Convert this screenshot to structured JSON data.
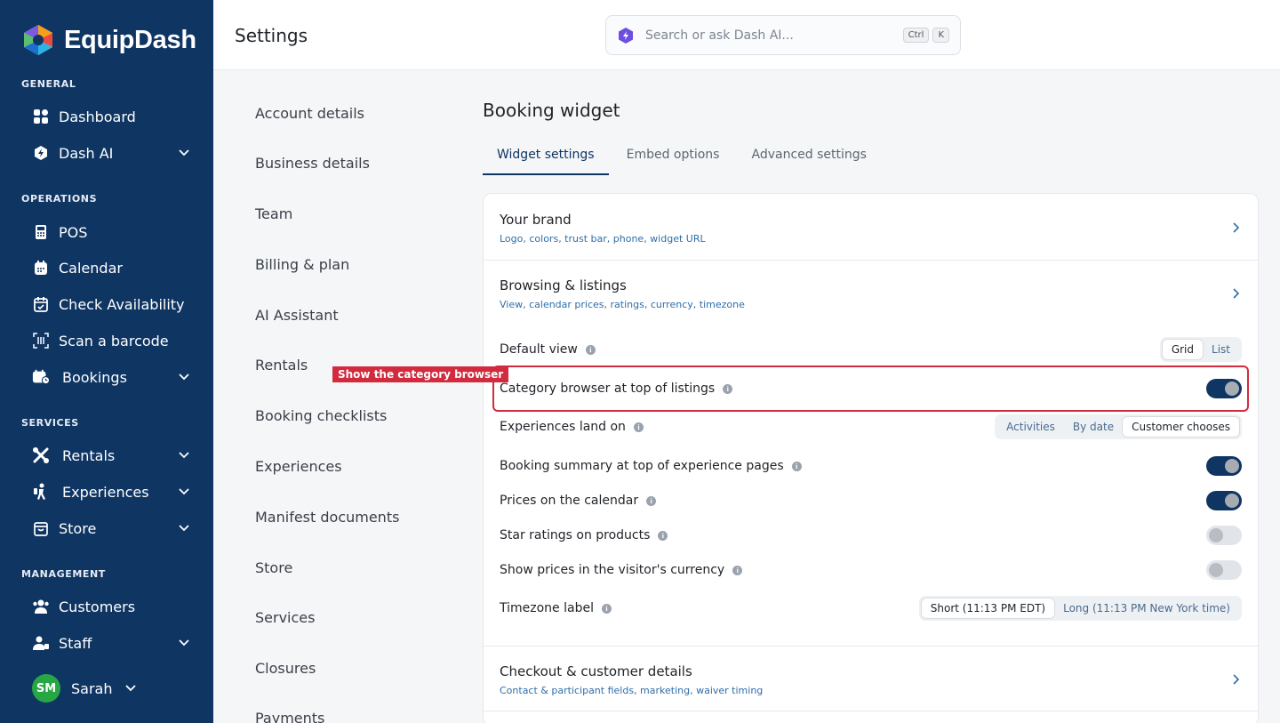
{
  "app": {
    "name": "EquipDash",
    "page_title": "Settings"
  },
  "colors": {
    "sidebar_bg": "#0f3563",
    "accent": "#0f3563",
    "callout": "#d12b3d",
    "avatar_bg": "#27a744"
  },
  "search": {
    "placeholder": "Search or ask Dash AI...",
    "shortcut_1": "Ctrl",
    "shortcut_2": "K"
  },
  "sidebar": {
    "sections": {
      "general": "GENERAL",
      "operations": "OPERATIONS",
      "services": "SERVICES",
      "management": "MANAGEMENT"
    },
    "items": [
      {
        "label": "Dashboard",
        "icon": "grid-icon"
      },
      {
        "label": "Dash AI",
        "icon": "ai-shield-icon"
      },
      {
        "label": "POS",
        "icon": "pos-terminal-icon"
      },
      {
        "label": "Calendar",
        "icon": "calendar-icon"
      },
      {
        "label": "Check Availability",
        "icon": "calendar-check-icon"
      },
      {
        "label": "Scan a barcode",
        "icon": "barcode-scan-icon"
      },
      {
        "label": "Bookings",
        "icon": "bookings-icon"
      },
      {
        "label": "Rentals",
        "icon": "rentals-icon"
      },
      {
        "label": "Experiences",
        "icon": "experiences-icon"
      },
      {
        "label": "Store",
        "icon": "store-bag-icon"
      },
      {
        "label": "Customers",
        "icon": "customers-icon"
      },
      {
        "label": "Staff",
        "icon": "staff-icon"
      }
    ],
    "user": {
      "initials": "SM",
      "name": "Sarah"
    }
  },
  "settings_nav": [
    "Account details",
    "Business details",
    "Team",
    "Billing & plan",
    "AI Assistant",
    "Rentals",
    "Booking checklists",
    "Experiences",
    "Manifest documents",
    "Store",
    "Services",
    "Closures",
    "Payments"
  ],
  "callout": "Show the category browser",
  "main": {
    "title": "Booking widget",
    "tabs": [
      "Widget settings",
      "Embed options",
      "Advanced settings"
    ],
    "groups": {
      "brand": {
        "title": "Your brand",
        "subtitle": "Logo, colors, trust bar, phone, widget URL"
      },
      "browsing": {
        "title": "Browsing & listings",
        "subtitle": "View, calendar prices, ratings, currency, timezone"
      },
      "checkout": {
        "title": "Checkout & customer details",
        "subtitle": "Contact & participant fields, marketing, waiver timing"
      }
    },
    "settings": {
      "default_view": {
        "label": "Default view",
        "options": [
          "Grid",
          "List"
        ],
        "selected": "Grid"
      },
      "category_browser": {
        "label": "Category browser at top of listings",
        "enabled": true
      },
      "experiences_land_on": {
        "label": "Experiences land on",
        "options": [
          "Activities",
          "By date",
          "Customer chooses"
        ],
        "selected": "Customer chooses"
      },
      "booking_summary": {
        "label": "Booking summary at top of experience pages",
        "enabled": true
      },
      "calendar_prices": {
        "label": "Prices on the calendar",
        "enabled": true
      },
      "star_ratings": {
        "label": "Star ratings on products",
        "enabled": false
      },
      "visitor_currency": {
        "label": "Show prices in the visitor's currency",
        "enabled": false
      },
      "timezone_label": {
        "label": "Timezone label",
        "options": [
          "Short (11:13 PM EDT)",
          "Long (11:13 PM New York time)"
        ],
        "selected": "Short (11:13 PM EDT)"
      }
    }
  }
}
